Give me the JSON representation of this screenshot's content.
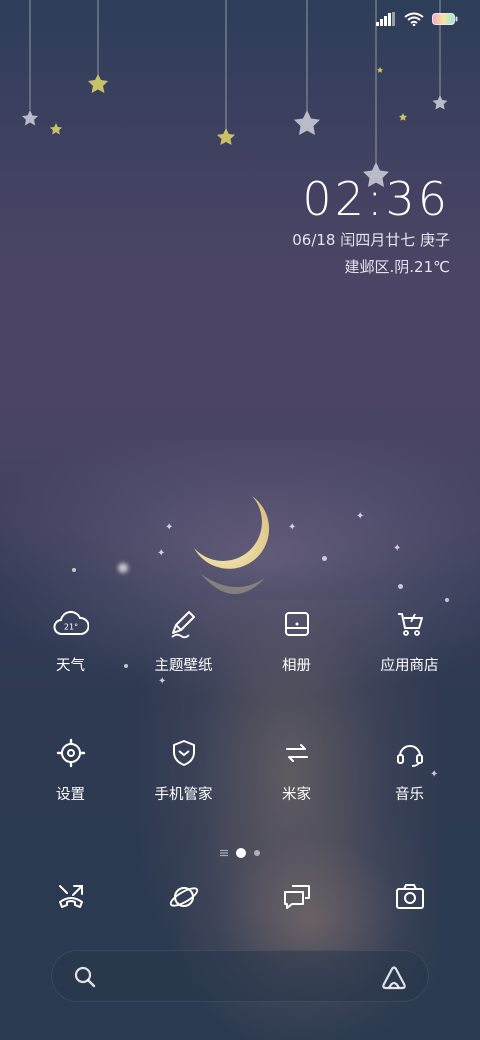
{
  "status_bar": {
    "signal_icon": "signal-bars-icon",
    "wifi_icon": "wifi-icon",
    "battery_icon": "battery-icon"
  },
  "clock": {
    "time": "02:36",
    "date": "06/18 闰四月廿七  庚子",
    "weather": "建邺区.阴.21℃"
  },
  "apps_row1": [
    {
      "label": "天气",
      "icon": "cloud-weather-icon",
      "badge": "21°"
    },
    {
      "label": "主题壁纸",
      "icon": "brush-icon"
    },
    {
      "label": "相册",
      "icon": "gallery-icon"
    },
    {
      "label": "应用商店",
      "icon": "shopping-cart-icon"
    }
  ],
  "apps_row2": [
    {
      "label": "设置",
      "icon": "gear-icon"
    },
    {
      "label": "手机管家",
      "icon": "shield-icon"
    },
    {
      "label": "米家",
      "icon": "mijia-icon"
    },
    {
      "label": "音乐",
      "icon": "headphones-icon"
    }
  ],
  "page_indicator": {
    "pages": 2,
    "current": 1
  },
  "dock": [
    {
      "icon": "phone-icon"
    },
    {
      "icon": "browser-icon"
    },
    {
      "icon": "messages-icon"
    },
    {
      "icon": "camera-icon"
    }
  ],
  "search": {
    "search_icon": "search-icon",
    "assistant_icon": "assistant-icon"
  },
  "colors": {
    "accent_star": "#c9c06a",
    "text": "#ffffff",
    "moon": "#e8d79a"
  }
}
